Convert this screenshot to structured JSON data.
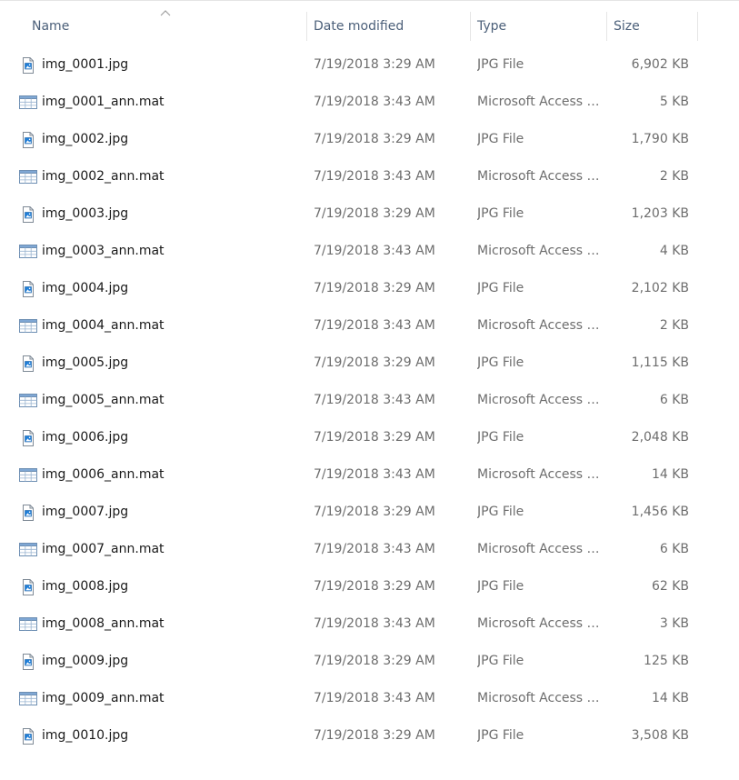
{
  "columns": {
    "name": "Name",
    "date": "Date modified",
    "type": "Type",
    "size": "Size"
  },
  "sort": {
    "column": "name",
    "icon": "chevron-up-icon"
  },
  "files": [
    {
      "name": "img_0001.jpg",
      "date": "7/19/2018 3:29 AM",
      "type": "JPG File",
      "size": "6,902 KB",
      "icon": "jpg-file-icon"
    },
    {
      "name": "img_0001_ann.mat",
      "date": "7/19/2018 3:43 AM",
      "type": "Microsoft Access T...",
      "size": "5 KB",
      "icon": "access-table-icon"
    },
    {
      "name": "img_0002.jpg",
      "date": "7/19/2018 3:29 AM",
      "type": "JPG File",
      "size": "1,790 KB",
      "icon": "jpg-file-icon"
    },
    {
      "name": "img_0002_ann.mat",
      "date": "7/19/2018 3:43 AM",
      "type": "Microsoft Access T...",
      "size": "2 KB",
      "icon": "access-table-icon"
    },
    {
      "name": "img_0003.jpg",
      "date": "7/19/2018 3:29 AM",
      "type": "JPG File",
      "size": "1,203 KB",
      "icon": "jpg-file-icon"
    },
    {
      "name": "img_0003_ann.mat",
      "date": "7/19/2018 3:43 AM",
      "type": "Microsoft Access T...",
      "size": "4 KB",
      "icon": "access-table-icon"
    },
    {
      "name": "img_0004.jpg",
      "date": "7/19/2018 3:29 AM",
      "type": "JPG File",
      "size": "2,102 KB",
      "icon": "jpg-file-icon"
    },
    {
      "name": "img_0004_ann.mat",
      "date": "7/19/2018 3:43 AM",
      "type": "Microsoft Access T...",
      "size": "2 KB",
      "icon": "access-table-icon"
    },
    {
      "name": "img_0005.jpg",
      "date": "7/19/2018 3:29 AM",
      "type": "JPG File",
      "size": "1,115 KB",
      "icon": "jpg-file-icon"
    },
    {
      "name": "img_0005_ann.mat",
      "date": "7/19/2018 3:43 AM",
      "type": "Microsoft Access T...",
      "size": "6 KB",
      "icon": "access-table-icon"
    },
    {
      "name": "img_0006.jpg",
      "date": "7/19/2018 3:29 AM",
      "type": "JPG File",
      "size": "2,048 KB",
      "icon": "jpg-file-icon"
    },
    {
      "name": "img_0006_ann.mat",
      "date": "7/19/2018 3:43 AM",
      "type": "Microsoft Access T...",
      "size": "14 KB",
      "icon": "access-table-icon"
    },
    {
      "name": "img_0007.jpg",
      "date": "7/19/2018 3:29 AM",
      "type": "JPG File",
      "size": "1,456 KB",
      "icon": "jpg-file-icon"
    },
    {
      "name": "img_0007_ann.mat",
      "date": "7/19/2018 3:43 AM",
      "type": "Microsoft Access T...",
      "size": "6 KB",
      "icon": "access-table-icon"
    },
    {
      "name": "img_0008.jpg",
      "date": "7/19/2018 3:29 AM",
      "type": "JPG File",
      "size": "62 KB",
      "icon": "jpg-file-icon"
    },
    {
      "name": "img_0008_ann.mat",
      "date": "7/19/2018 3:43 AM",
      "type": "Microsoft Access T...",
      "size": "3 KB",
      "icon": "access-table-icon"
    },
    {
      "name": "img_0009.jpg",
      "date": "7/19/2018 3:29 AM",
      "type": "JPG File",
      "size": "125 KB",
      "icon": "jpg-file-icon"
    },
    {
      "name": "img_0009_ann.mat",
      "date": "7/19/2018 3:43 AM",
      "type": "Microsoft Access T...",
      "size": "14 KB",
      "icon": "access-table-icon"
    },
    {
      "name": "img_0010.jpg",
      "date": "7/19/2018 3:29 AM",
      "type": "JPG File",
      "size": "3,508 KB",
      "icon": "jpg-file-icon"
    }
  ]
}
